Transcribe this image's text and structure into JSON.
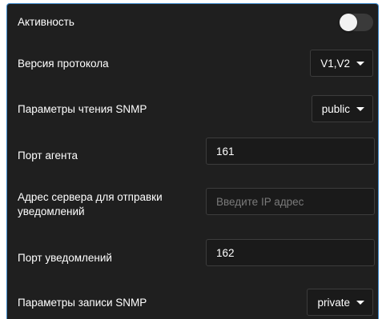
{
  "settings": {
    "activity": {
      "label": "Активность",
      "enabled": false
    },
    "protocol_version": {
      "label": "Версия протокола",
      "value": "V1,V2"
    },
    "snmp_read": {
      "label": "Параметры чтения SNMP",
      "value": "public"
    },
    "agent_port": {
      "label": "Порт агента",
      "value": "161"
    },
    "trap_server": {
      "label_line1": "Адрес сервера для отправки",
      "label_line2": "уведомлений",
      "value": "",
      "placeholder": "Введите IP адрес"
    },
    "trap_port": {
      "label": "Порт уведомлений",
      "value": "162"
    },
    "snmp_write": {
      "label": "Параметры записи SNMP",
      "value": "private"
    }
  },
  "colors": {
    "panel_bg": "#1f1f1f",
    "border_accent": "#3a86c8",
    "field_border": "#3c3c3c"
  }
}
